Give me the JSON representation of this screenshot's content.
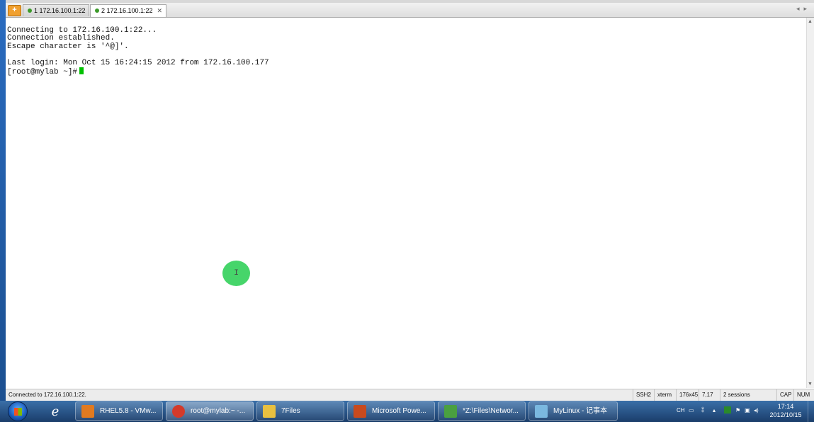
{
  "tabs": [
    {
      "label": "1 172.16.100.1:22",
      "active": false
    },
    {
      "label": "2 172.16.100.1:22",
      "active": true
    }
  ],
  "terminal": {
    "lines": [
      "Connecting to 172.16.100.1:22...",
      "Connection established.",
      "Escape character is '^@]'.",
      "",
      "Last login: Mon Oct 15 16:24:15 2012 from 172.16.100.177"
    ],
    "prompt": "[root@mylab ~]#"
  },
  "statusbar": {
    "message": "Connected to 172.16.100.1:22.",
    "protocol": "SSH2",
    "term": "xterm",
    "size": "176x45",
    "cursor": "7,17",
    "sessions": "2 sessions",
    "caps": "CAP",
    "num": "NUM"
  },
  "taskbar": {
    "items": [
      {
        "label": "RHEL5.8 - VMw...",
        "color": "#e07a20"
      },
      {
        "label": "root@mylab:~ -...",
        "color": "#d33a2a"
      },
      {
        "label": "7Files",
        "color": "#e8c040"
      },
      {
        "label": "Microsoft Powe...",
        "color": "#c84a1e"
      },
      {
        "label": "*Z:\\Files\\Networ...",
        "color": "#4aa040"
      },
      {
        "label": "MyLinux - 记事本",
        "color": "#7ab8e0"
      }
    ],
    "tray_lang": "CH",
    "clock_time": "17:14",
    "clock_date": "2012/10/15"
  },
  "click_indicator_glyph": "I",
  "colors": {
    "cursor": "#00c000",
    "click_indicator": "#33d15a"
  }
}
